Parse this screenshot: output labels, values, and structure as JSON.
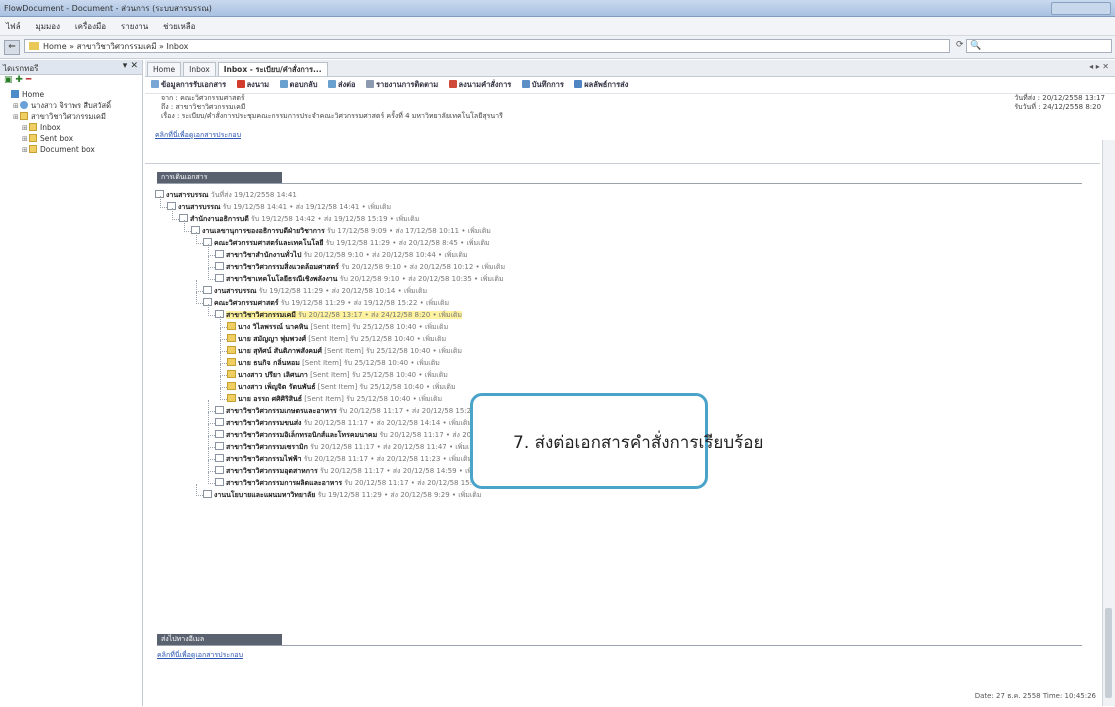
{
  "window": {
    "title": "FlowDocument - Document - ส่วนการ (ระบบสารบรรณ)"
  },
  "menu": [
    "ไฟล์",
    "มุมมอง",
    "เครื่องมือ",
    "รายงาน",
    "ช่วยเหลือ"
  ],
  "address": {
    "path": "Home » สาขาวิชาวิศวกรรมเคมี » Inbox",
    "search_icon": "search-icon"
  },
  "sidebar": {
    "title": "ไดเรกทอรี",
    "tree": [
      {
        "label": "Home",
        "icon": "home-icon",
        "indent": 0
      },
      {
        "label": "นางสาว จิราพร สืบสวัสดิ์",
        "icon": "user-icon",
        "indent": 1
      },
      {
        "label": "สาขาวิชาวิศวกรรมเคมี",
        "icon": "group-icon",
        "indent": 1
      },
      {
        "label": "Inbox",
        "icon": "folder-icon",
        "indent": 2
      },
      {
        "label": "Sent box",
        "icon": "folder-icon",
        "indent": 2
      },
      {
        "label": "Document box",
        "icon": "folder-icon",
        "indent": 2
      }
    ]
  },
  "tabs": [
    "Home",
    "Inbox",
    "Inbox - ระเบียบ/คำสั่งการ..."
  ],
  "toolbar": [
    "ข้อมูลการรับเอกสาร",
    "ลงนาม",
    "ตอบกลับ",
    "ส่งต่อ",
    "รายงานการติดตาม",
    "ลงนามคำสั่งการ",
    "บันทึกการ",
    "ผลลัพธ์การส่ง"
  ],
  "header": {
    "from": "จาก : คณะวิศวกรรมศาสตร์",
    "to": "ถึง : สาขาวิชาวิศวกรรมเคมี",
    "subject": "เรื่อง : ระเบียบ/คำสั่งการประชุมคณะกรรมการประจำคณะวิศวกรรมศาสตร์ ครั้งที่ 4 มหาวิทยาลัยเทคโนโลยีสุรนารี",
    "sent": "วันที่ส่ง : 20/12/2558 13:17",
    "received": "รับวันที่ : 24/12/2558 8:20",
    "attach_link": "คลิกที่นี่เพื่อดูเอกสารประกอบ"
  },
  "section1": "การเดินเอกสาร",
  "doc_tree": [
    {
      "name": "งานสารบรรณ",
      "meta": "วันที่ส่ง 19/12/2558 14:41",
      "indent": 0,
      "folder": false
    },
    {
      "name": "งานสารบรรณ",
      "meta": "รับ 19/12/58 14:41 • ส่ง 19/12/58 14:41 • เพิ่มเติม",
      "indent": 1,
      "folder": false
    },
    {
      "name": "สำนักงานอธิการบดี",
      "meta": "รับ 19/12/58 14:42 • ส่ง 19/12/58 15:19 • เพิ่มเติม",
      "indent": 2,
      "folder": false
    },
    {
      "name": "งานเลขานุการของอธิการบดีฝ่ายวิชาการ",
      "meta": "รับ 17/12/58 9:09 • ส่ง 17/12/58 10:11 • เพิ่มเติม",
      "indent": 3,
      "folder": false
    },
    {
      "name": "คณะวิศวกรรมศาสตร์และเทคโนโลยี",
      "meta": "รับ 19/12/58 11:29 • ส่ง 20/12/58 8:45 • เพิ่มเติม",
      "indent": 4,
      "folder": false
    },
    {
      "name": "สาขาวิชาสำนักงานทั่วไป",
      "meta": "รับ 20/12/58 9:10 • ส่ง 20/12/58 10:44 • เพิ่มเติม",
      "indent": 5,
      "folder": false
    },
    {
      "name": "สาขาวิชาวิศวกรรมสิ่งแวดล้อมศาสตร์",
      "meta": "รับ 20/12/58 9:10 • ส่ง 20/12/58 10:12 • เพิ่มเติม",
      "indent": 5,
      "folder": false
    },
    {
      "name": "สาขาวิชาเทคโนโลยีธรณีเชิงพลังงาน",
      "meta": "รับ 20/12/58 9:10 • ส่ง 20/12/58 10:35 • เพิ่มเติม",
      "indent": 5,
      "folder": false
    },
    {
      "name": "งานสารบรรณ",
      "meta": "รับ 19/12/58 11:29 • ส่ง 20/12/58 10:14 • เพิ่มเติม",
      "indent": 4,
      "folder": false
    },
    {
      "name": "คณะวิศวกรรมศาสตร์",
      "meta": "รับ 19/12/58 11:29 • ส่ง 19/12/58 15:22 • เพิ่มเติม",
      "indent": 4,
      "folder": false
    },
    {
      "name": "สาขาวิชาวิศวกรรมเคมี",
      "meta": "รับ 20/12/58 13:17 • ส่ง 24/12/58 8:20 • เพิ่มเติม",
      "indent": 5,
      "folder": false,
      "highlight": true
    },
    {
      "name": "นาง วิไลพรรณ์ นาคหิน",
      "meta": "[Sent Item] รับ 25/12/58 10:40 • เพิ่มเติม",
      "indent": 6,
      "folder": true
    },
    {
      "name": "นาย สมัญญา พุ่มพวงศ์",
      "meta": "[Sent Item] รับ 25/12/58 10:40 • เพิ่มเติม",
      "indent": 6,
      "folder": true
    },
    {
      "name": "นาย สุทัศน์ สันติภาพสังคมศ์",
      "meta": "[Sent Item] รับ 25/12/58 10:40 • เพิ่มเติม",
      "indent": 6,
      "folder": true
    },
    {
      "name": "นาย ธนกิจ กลิ่นหอม",
      "meta": "[Sent Item] รับ 25/12/58 10:40 • เพิ่มเติม",
      "indent": 6,
      "folder": true
    },
    {
      "name": "นางสาว ปรียา เลิศนภา",
      "meta": "[Sent Item] รับ 25/12/58 10:40 • เพิ่มเติม",
      "indent": 6,
      "folder": true
    },
    {
      "name": "นางสาว เพ็ญจิต รัตนพันธ์",
      "meta": "[Sent Item] รับ 25/12/58 10:40 • เพิ่มเติม",
      "indent": 6,
      "folder": true
    },
    {
      "name": "นาย อรรถ ศศิศิริสินธ์",
      "meta": "[Sent Item] รับ 25/12/58 10:40 • เพิ่มเติม",
      "indent": 6,
      "folder": true
    },
    {
      "name": "สาขาวิชาวิศวกรรมเกษตรและอาหาร",
      "meta": "รับ 20/12/58 11:17 • ส่ง 20/12/58 15:29 • เพิ่มเติม",
      "indent": 5,
      "folder": false
    },
    {
      "name": "สาขาวิชาวิศวกรรมขนส่ง",
      "meta": "รับ 20/12/58 11:17 • ส่ง 20/12/58 14:14 • เพิ่มเติม",
      "indent": 5,
      "folder": false
    },
    {
      "name": "สาขาวิชาวิศวกรรมอิเล็กทรอนิกส์และโทรคมนาคม",
      "meta": "รับ 20/12/58 11:17 • ส่ง 20/12/58 14:20 • เพิ่มเติม",
      "indent": 5,
      "folder": false
    },
    {
      "name": "สาขาวิชาวิศวกรรมเซรามิก",
      "meta": "รับ 20/12/58 11:17 • ส่ง 20/12/58 11:47 • เพิ่มเติม",
      "indent": 5,
      "folder": false
    },
    {
      "name": "สาขาวิชาวิศวกรรมไฟฟ้า",
      "meta": "รับ 20/12/58 11:17 • ส่ง 20/12/58 11:23 • เพิ่มเติม",
      "indent": 5,
      "folder": false
    },
    {
      "name": "สาขาวิชาวิศวกรรมอุตสาหการ",
      "meta": "รับ 20/12/58 11:17 • ส่ง 20/12/58 14:59 • เพิ่มเติม",
      "indent": 5,
      "folder": false
    },
    {
      "name": "สาขาวิชาวิศวกรรมการผลิตและอาหาร",
      "meta": "รับ 20/12/58 11:17 • ส่ง 20/12/58 15:11 • เพิ่มเติม",
      "indent": 5,
      "folder": false
    },
    {
      "name": "งานนโยบายและแผนมหาวิทยาลัย",
      "meta": "รับ 19/12/58 11:29 • ส่ง 20/12/58 9:29 • เพิ่มเติม",
      "indent": 4,
      "folder": false
    }
  ],
  "section2": "ส่งไปทางอีเมล",
  "reply_link": "คลิกที่นี่เพื่อดูเอกสารประกอบ",
  "status": {
    "date": "Date: 27 ธ.ค. 2558 Time: 10:45:26"
  },
  "callout": {
    "text": "7. ส่งต่อเอกสารคำสั่งการเรียบร้อย",
    "border_color": "#4aa3c8"
  }
}
